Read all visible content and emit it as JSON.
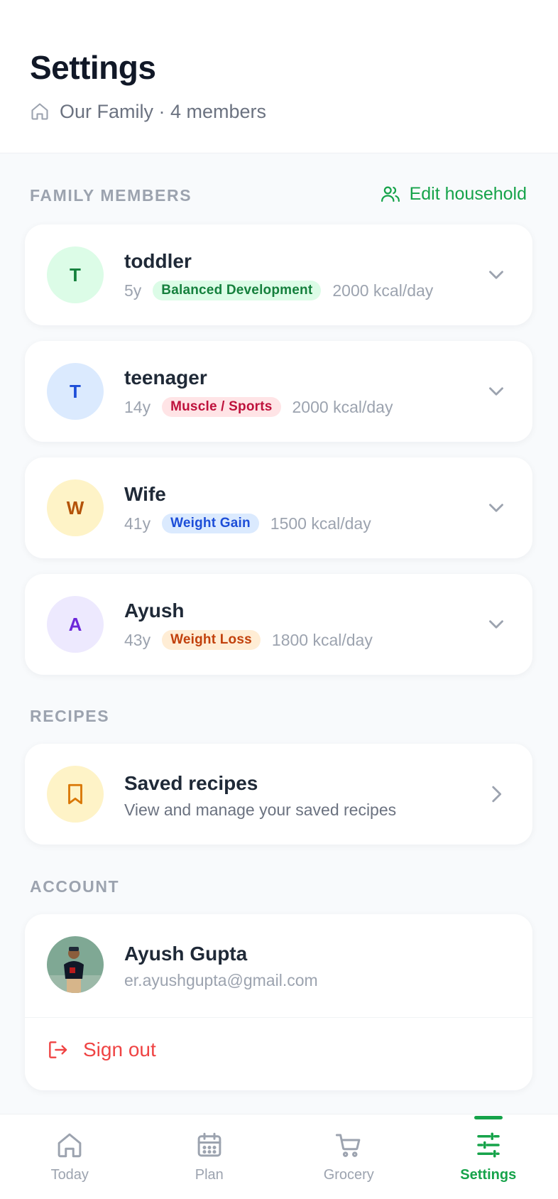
{
  "header": {
    "title": "Settings",
    "household": "Our Family · 4 members"
  },
  "sections": {
    "family_members": "FAMILY MEMBERS",
    "edit_household": "Edit household",
    "recipes": "RECIPES",
    "account": "ACCOUNT"
  },
  "members": [
    {
      "initial": "T",
      "name": "toddler",
      "age": "5y",
      "goal": "Balanced Development",
      "calories": "2000 kcal/day",
      "avatar_bg": "#dcfce7",
      "avatar_fg": "#15803d",
      "badge_bg": "#dcfce7",
      "badge_fg": "#15803d"
    },
    {
      "initial": "T",
      "name": "teenager",
      "age": "14y",
      "goal": "Muscle / Sports",
      "calories": "2000 kcal/day",
      "avatar_bg": "#dbeafe",
      "avatar_fg": "#1d4ed8",
      "badge_bg": "#ffe4e6",
      "badge_fg": "#be123c"
    },
    {
      "initial": "W",
      "name": "Wife",
      "age": "41y",
      "goal": "Weight Gain",
      "calories": "1500 kcal/day",
      "avatar_bg": "#fef3c7",
      "avatar_fg": "#b45309",
      "badge_bg": "#dbeafe",
      "badge_fg": "#1d4ed8"
    },
    {
      "initial": "A",
      "name": "Ayush",
      "age": "43y",
      "goal": "Weight Loss",
      "calories": "1800 kcal/day",
      "avatar_bg": "#ede9fe",
      "avatar_fg": "#6d28d9",
      "badge_bg": "#ffedd5",
      "badge_fg": "#c2410c"
    }
  ],
  "recipes": {
    "title": "Saved recipes",
    "subtitle": "View and manage your saved recipes"
  },
  "account": {
    "name": "Ayush Gupta",
    "email": "er.ayushgupta@gmail.com",
    "signout": "Sign out"
  },
  "nav": {
    "items": [
      {
        "label": "Today",
        "icon": "home-icon"
      },
      {
        "label": "Plan",
        "icon": "calendar-icon"
      },
      {
        "label": "Grocery",
        "icon": "cart-icon"
      },
      {
        "label": "Settings",
        "icon": "sliders-icon"
      }
    ],
    "active": "Settings"
  },
  "colors": {
    "accent": "#16a34a",
    "danger": "#ef4444"
  }
}
